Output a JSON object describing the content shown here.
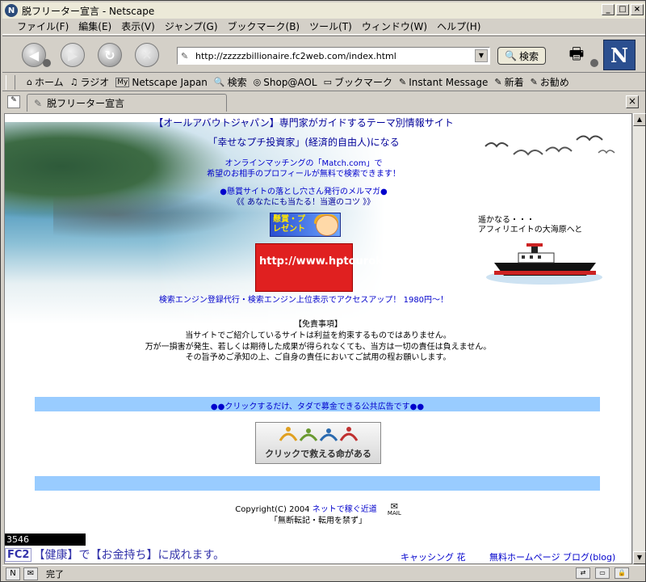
{
  "window": {
    "title": "脱フリーター宣言 - Netscape",
    "minimize": "_",
    "maximize": "□",
    "close": "×"
  },
  "menu": [
    "ファイル(F)",
    "編集(E)",
    "表示(V)",
    "ジャンプ(G)",
    "ブックマーク(B)",
    "ツール(T)",
    "ウィンドウ(W)",
    "ヘルプ(H)"
  ],
  "nav": {
    "url": "http://zzzzzbillionaire.fc2web.com/index.html",
    "search_label": "検索",
    "logo_letter": "N"
  },
  "personal_toolbar": [
    {
      "icon": "⌂",
      "label": "ホーム"
    },
    {
      "icon": "♫",
      "label": "ラジオ"
    },
    {
      "icon": "My",
      "label": "Netscape Japan"
    },
    {
      "icon": "🔍",
      "label": "検索"
    },
    {
      "icon": "◎",
      "label": "Shop@AOL"
    },
    {
      "icon": "▭",
      "label": "ブックマーク"
    },
    {
      "icon": "✎",
      "label": "Instant Message"
    },
    {
      "icon": "✎",
      "label": "新着"
    },
    {
      "icon": "✎",
      "label": "お勧め"
    }
  ],
  "tab": {
    "label": "脱フリーター宣言",
    "close": "×"
  },
  "page": {
    "headline": "【オールアバウトジャパン】専門家がガイドするテーマ別情報サイト",
    "subhead": "「幸せなプチ投資家」(経済的自由人)になる",
    "match_line1": "オンラインマッチングの「Match.com」で",
    "match_line2": "希望のお相手のプロフィールが無料で検索できます！",
    "magazine_line1": "●懸賞サイトの落とし穴さん発行のメルマガ●",
    "magazine_line2": "《《 あなたにも当たる！当選のコツ 》》",
    "banner1_text": "懸賞・プレゼント",
    "banner2_text": "http://www.hptouroku.com/",
    "seo_line": "検索エンジン登録代行・検索エンジン上位表示でアクセスアップ！ 1980円〜！",
    "tagline_1": "遥かなる・・・",
    "tagline_2": "アフィリエイトの大海原へと",
    "disclaimer_title": "【免責事項】",
    "disclaimer_1": "当サイトでご紹介しているサイトは利益を約束するものではありません。",
    "disclaimer_2": "万が一損害が発生、若しくは期待した成果が得られなくても、当方は一切の責任は負えません。",
    "disclaimer_3": "その旨予めご承知の上、ご自身の責任においてご試用の程お願いします。",
    "ad_bar_text": "●●クリックするだけ、タダで募金できる公共広告です●●",
    "click_banner_text": "クリックで救える命がある",
    "copyright_prefix": "Copyright(C) 2004 ",
    "copyright_link": "ネットで稼ぐ近道",
    "mail_label": "MAIL",
    "no_copy": "「無断転記・転用を禁ず」",
    "counter": "3546",
    "fc2_badge": "FC2",
    "fc2_text": "【健康】で【お金持ち】に成れます。",
    "footer_link1": "キャッシング 花",
    "footer_link2": "無料ホームページ ブログ(blog)"
  },
  "status": {
    "text": "完了"
  }
}
